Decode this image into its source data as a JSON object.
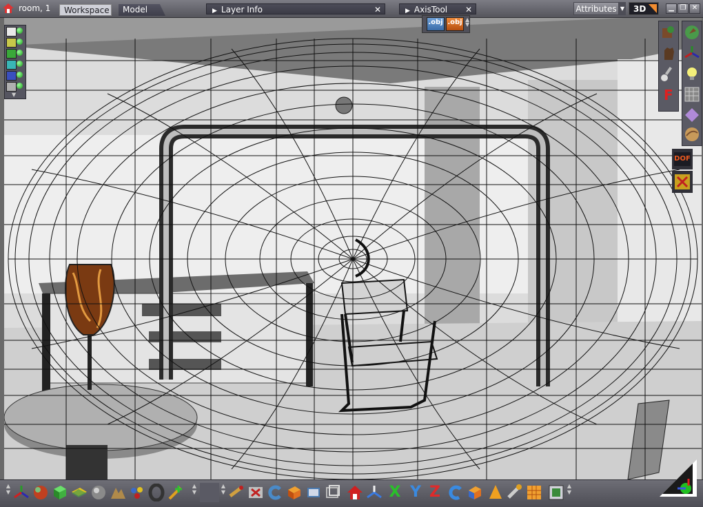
{
  "titlebar": {
    "document": "room, 1",
    "tabs": [
      {
        "label": "Workspace",
        "active": true
      },
      {
        "label": "Model",
        "active": false
      }
    ],
    "panels": [
      {
        "label": "Layer Info"
      },
      {
        "label": "AxisTool"
      }
    ],
    "attributes_label": "Attributes",
    "mode_label": "3D",
    "window_buttons": [
      "minimize",
      "restore",
      "close"
    ]
  },
  "object_strip": {
    "buttons": [
      ".obj",
      ".obj"
    ]
  },
  "left_palette": {
    "layers": [
      {
        "color": "#e9e9e9"
      },
      {
        "color": "#c8c84a"
      },
      {
        "color": "#3aa83a"
      },
      {
        "color": "#39b6b6"
      },
      {
        "color": "#3a4fbf"
      }
    ]
  },
  "right_palette": {
    "tools": [
      "model-tool-icon",
      "hand-tool-icon",
      "lightbulb-icon",
      "paint-brush-icon",
      "grid-icon",
      "fuel-f-icon",
      "material-sphere-icon",
      "dof-icon",
      "transform-x-icon"
    ],
    "dof_label": "DOF"
  },
  "bottom_toolbar": {
    "axis_labels": [
      "X",
      "Y",
      "Z"
    ]
  },
  "colors": {
    "chrome": "#5a5a64",
    "accent": "#f08c30",
    "viewport": "#d8d8d8"
  }
}
